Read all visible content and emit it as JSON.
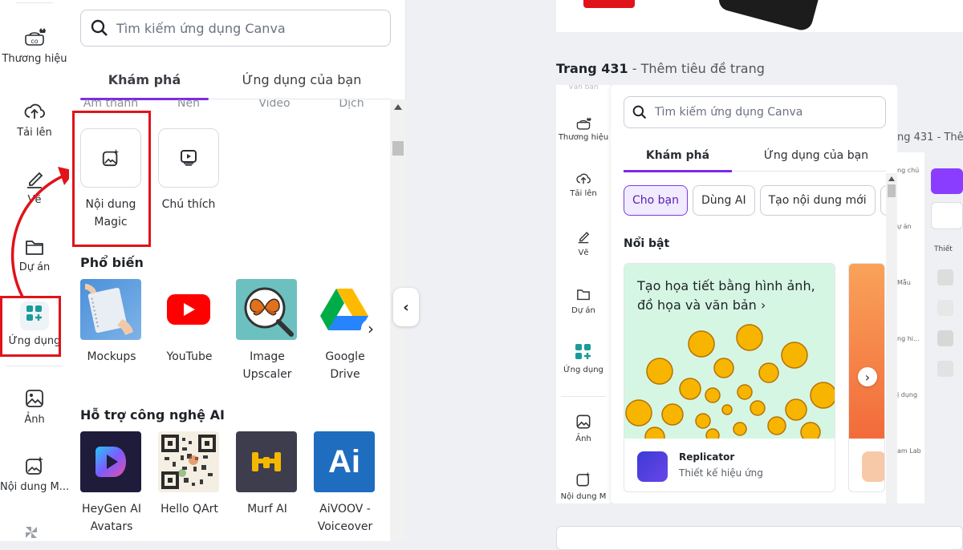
{
  "rail": {
    "items": [
      {
        "label": "Thương hiệu",
        "icon": "brand-icon"
      },
      {
        "label": "Tải lên",
        "icon": "upload-cloud-icon"
      },
      {
        "label": "Vẽ",
        "icon": "draw-icon"
      },
      {
        "label": "Dự án",
        "icon": "folder-icon"
      },
      {
        "label": "Ứng dụng",
        "icon": "apps-icon"
      },
      {
        "label": "Ảnh",
        "icon": "image-icon"
      },
      {
        "label": "Nội dung M...",
        "icon": "magic-image-icon"
      }
    ]
  },
  "panel": {
    "search_placeholder": "Tìm kiếm ứng dụng Canva",
    "tabs": [
      "Khám phá",
      "Ứng dụng của bạn"
    ],
    "subtabs": [
      "Âm thanh",
      "Nền",
      "Video",
      "Dịch"
    ],
    "featured": [
      {
        "label": "Nội dung Magic",
        "icon": "magic-image-icon"
      },
      {
        "label": "Chú thích",
        "icon": "caption-icon"
      }
    ],
    "popular_title": "Phổ biến",
    "popular": [
      {
        "label": "Mockups"
      },
      {
        "label": "YouTube"
      },
      {
        "label": "Image Upscaler"
      },
      {
        "label": "Google Drive"
      }
    ],
    "ai_title": "Hỗ trợ công nghệ AI",
    "ai": [
      {
        "label": "HeyGen AI Avatars"
      },
      {
        "label": "Hello QArt"
      },
      {
        "label": "Murf AI"
      },
      {
        "label": "AiVOOV - Voiceover",
        "logo_text": "Ai"
      }
    ]
  },
  "canvas": {
    "page_number": "Trang 431",
    "page_title_sep": " - ",
    "page_title_placeholder": "Thêm tiêu đề trang",
    "overflow_title": "ng 431 - Thê",
    "mini": {
      "rail": [
        {
          "label": "Văn bản"
        },
        {
          "label": "Thương hiệu"
        },
        {
          "label": "Tải lên"
        },
        {
          "label": "Vẽ"
        },
        {
          "label": "Dự án"
        },
        {
          "label": "Ứng dụng"
        },
        {
          "label": "Ảnh"
        },
        {
          "label": "Nội dung M"
        }
      ],
      "search_placeholder": "Tìm kiếm ứng dụng Canva",
      "tabs": [
        "Khám phá",
        "Ứng dụng của bạn"
      ],
      "chips": [
        "Cho bạn",
        "Dùng AI",
        "Tạo nội dung mới"
      ],
      "featured_title": "Nổi bật",
      "card_text": "Tạo họa tiết bằng hình ảnh, đồ họa và văn bản",
      "card_arrow": "›",
      "app_name": "Replicator",
      "app_desc": "Thiết kế hiệu ứng",
      "side_labels": [
        "ng chủ",
        "ự án",
        "Mẫu",
        "ng hi...",
        "ị dụng",
        "am Lab"
      ],
      "side_text": "Thiết"
    }
  },
  "colors": {
    "accent": "#7d2ae8",
    "highlight": "#e0131a",
    "brand_purple": "#8b3dff"
  }
}
